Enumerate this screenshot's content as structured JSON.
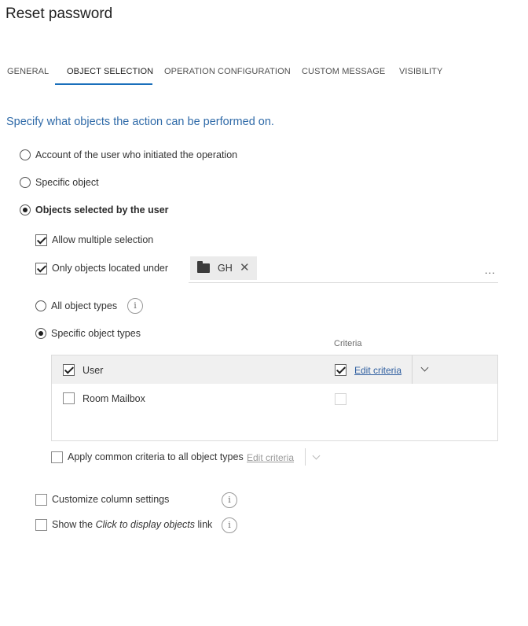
{
  "page": {
    "title": "Reset password"
  },
  "tabs": [
    {
      "label": "GENERAL",
      "active": false
    },
    {
      "label": "OBJECT SELECTION",
      "active": true
    },
    {
      "label": "OPERATION CONFIGURATION",
      "active": false
    },
    {
      "label": "CUSTOM MESSAGE",
      "active": false
    },
    {
      "label": "VISIBILITY",
      "active": false
    }
  ],
  "subtitle": "Specify what objects the action can be performed on.",
  "target_options": [
    {
      "label": "Account of the user who initiated the operation",
      "selected": false
    },
    {
      "label": "Specific object",
      "selected": false
    },
    {
      "label": "Objects selected by the user",
      "selected": true
    }
  ],
  "selection": {
    "allow_multiple": {
      "label": "Allow multiple selection",
      "checked": true
    },
    "only_under": {
      "label": "Only objects located under",
      "checked": true,
      "chip": {
        "icon": "folder-icon",
        "text": "GH"
      },
      "more_label": "..."
    }
  },
  "object_type_options": [
    {
      "label": "All object types",
      "selected": false
    },
    {
      "label": "Specific object types",
      "selected": true
    }
  ],
  "object_types": {
    "criteria_header": "Criteria",
    "rows": [
      {
        "label": "User",
        "checked": true,
        "criteria_checked": true,
        "criteria_link": "Edit criteria"
      },
      {
        "label": "Room Mailbox",
        "checked": false,
        "criteria_checked": false,
        "criteria_link": ""
      }
    ]
  },
  "common_criteria": {
    "label": "Apply common criteria to all object types",
    "checked": false,
    "link": "Edit criteria"
  },
  "customize_columns": {
    "label": "Customize column settings",
    "checked": false
  },
  "show_link": {
    "prefix": "Show the ",
    "italic": "Click to display objects",
    "suffix": " link",
    "checked": false
  },
  "info_glyph": "i",
  "colors": {
    "accent": "#1a6fbb",
    "subtitle": "#2f6aa8",
    "link": "#2f5fa0",
    "selected_row": "#f0f0f0"
  }
}
